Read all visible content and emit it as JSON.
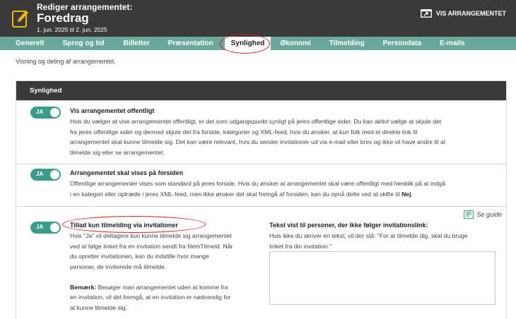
{
  "header": {
    "subtitle": "Rediger arrangementet:",
    "title": "Foredrag",
    "dates": "1. jun. 2025 til 2. jun. 2025",
    "view_label": "VIS ARRANGEMENTET"
  },
  "tabs": [
    {
      "label": "Generelt"
    },
    {
      "label": "Sprog og tid"
    },
    {
      "label": "Billetter"
    },
    {
      "label": "Præsentation"
    },
    {
      "label": "Synlighed"
    },
    {
      "label": "Økonomi"
    },
    {
      "label": "Tilmelding"
    },
    {
      "label": "Persondata"
    },
    {
      "label": "E-mails"
    }
  ],
  "active_tab": "Synlighed",
  "intro": "Visning og deling af arrangementet.",
  "panel": {
    "title": "Synlighed",
    "rows": [
      {
        "toggle_label": "JA",
        "title": "Vis arrangementet offentligt",
        "lines": [
          "Hvis du vælger at vise arrangementet offentligt, er det som udgangspunkt synligt på jeres offentlige sider. Du kan aktivt vælge at skjule det",
          "fra jeres offentlige sider og dermed skjule det fra forside, kategorier og XML-feed, hvis du ønsker, at kun folk med et direkte link til",
          "arrangementet skal kunne tilmelde sig. Det kan være relevant, hvis du sender invitationer ud via e-mail eller brev og ikke vil have andre til at",
          "tilmelde sig eller se arrangementet."
        ]
      },
      {
        "toggle_label": "JA",
        "title": "Arrangementet skal vises på forsiden",
        "line1": "Offentlige arrangementer vises som standard på jeres forside. Hvis du ønsker at arrangementet skal være offentligt med henblik på at indgå",
        "line2_prefix": "i en kategori eller optræde i jeres XML-feed, men ikke ønsker det skal fremgå af forsiden, kan du opnå dette ved at skifte til ",
        "line2_bold": "Nej",
        "line2_suffix": "."
      },
      {
        "toggle_label": "JA",
        "guide_label": "Se guide",
        "title": "Tillad kun tilmelding via invitationer",
        "lines": [
          "Hvis \"Ja\" vil deltagere kun kunne tilmelde sig arrangementet",
          "ved at følge linket fra en invitation sendt fra NemTilmeld. Når",
          "du opretter invitationen, kan du indstille hvor mange",
          "personer, de inviterede må tilmelde."
        ],
        "note_label": "Bemærk:",
        "note_first": " Besøger man arrangementet uden at komme fra",
        "note_lines": [
          "en invitation, vil det fremgå, at en invitation er nødvendig for",
          "at kunne tilmelde sig."
        ],
        "right_title": "Tekst vist til personer, der ikke følger invitationslink:",
        "right_lines": [
          "Hvis ikke du skriver en tekst, vil der stå: \"For at tilmelde dig, skal du bruge",
          "linket fra din invitation.\""
        ],
        "textarea_value": ""
      }
    ]
  },
  "colors": {
    "header_bg": "#3a3a3a",
    "tab_bar": "#69a89b",
    "toggle_on": "#3a9d8a",
    "highlight_ring": "#d71b1b"
  }
}
